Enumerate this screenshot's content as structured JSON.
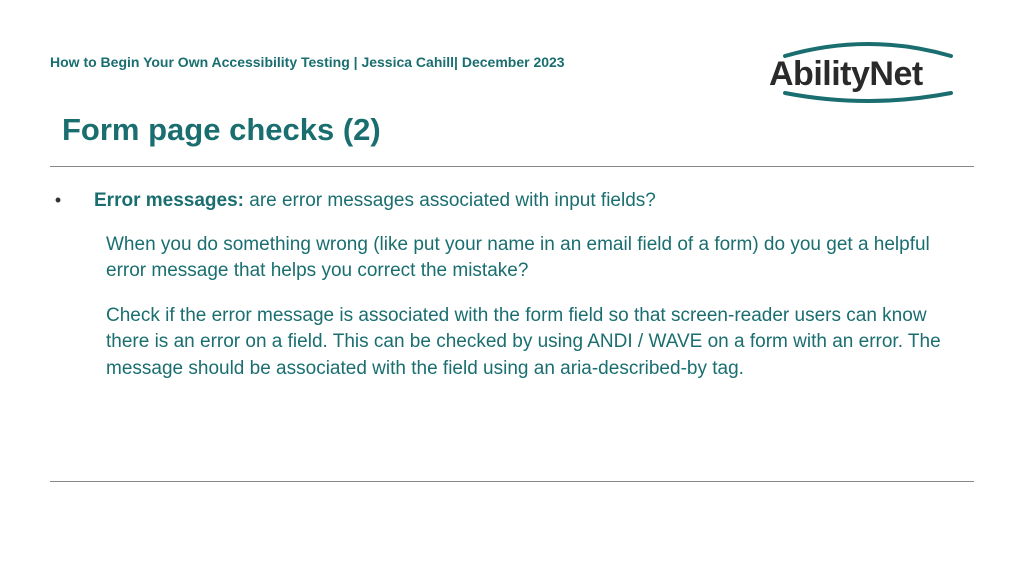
{
  "header": {
    "line": "How to Begin Your Own Accessibility Testing | Jessica Cahill| December 2023"
  },
  "logo": {
    "text": "AbilityNet"
  },
  "title": "Form page checks (2)",
  "bullet": {
    "marker": "•",
    "label": "Error messages:",
    "rest": " are error messages associated with input fields?"
  },
  "paragraphs": {
    "p1": "When you do something wrong (like put your name in an email field of a form) do you get a helpful error message that helps you correct the mistake?",
    "p2": "Check if the error message is associated with the form field so that screen-reader users can know there is an error on a field. This can be checked by using ANDI / WAVE on a form with an error. The message should be associated with the field using an aria-described-by tag."
  }
}
